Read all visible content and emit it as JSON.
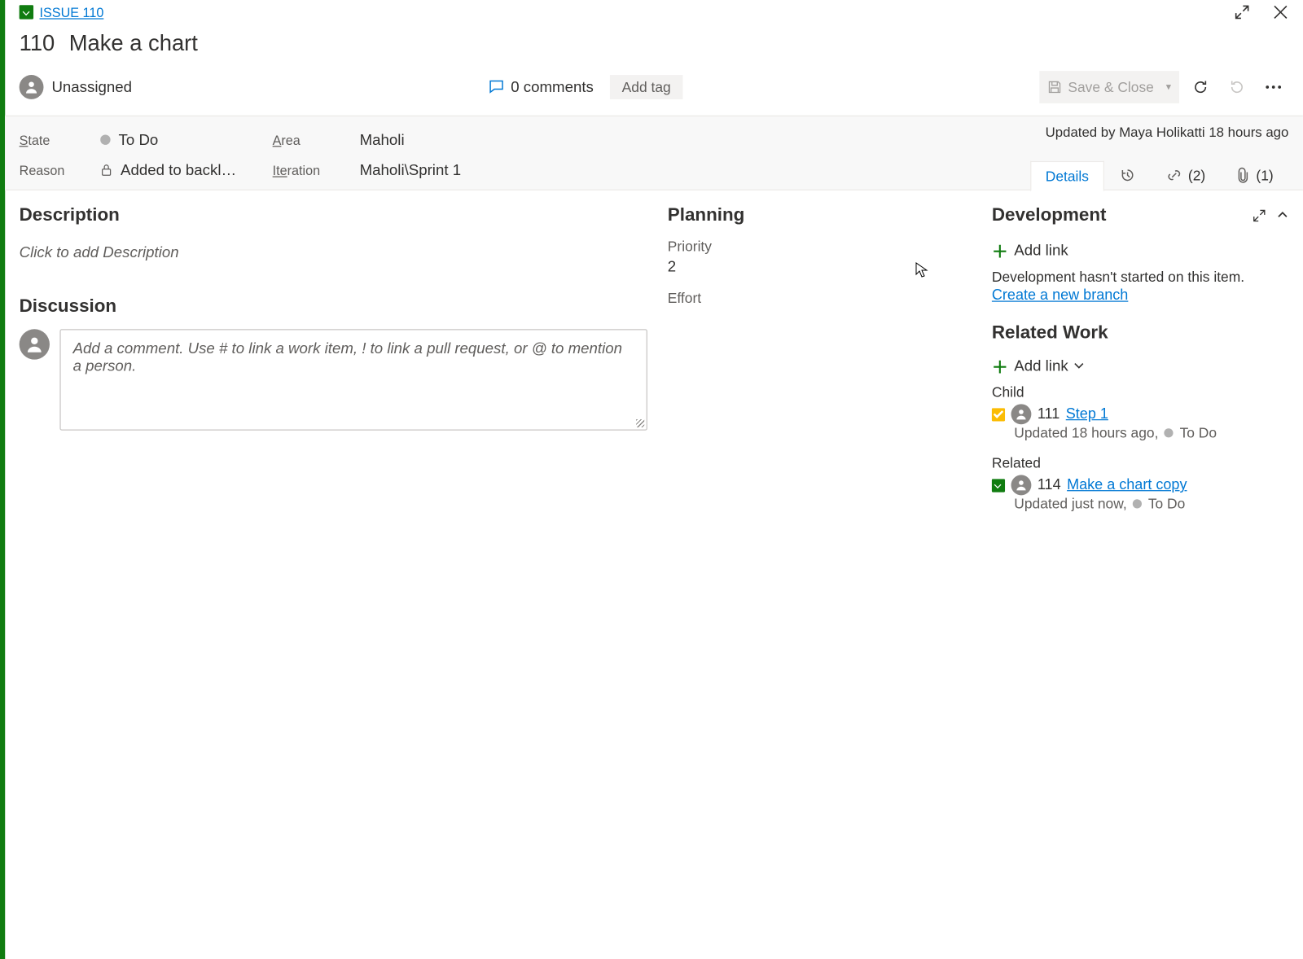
{
  "breadcrumb": {
    "label": "ISSUE 110"
  },
  "title": {
    "id": "110",
    "text": "Make a chart"
  },
  "assignee": {
    "text": "Unassigned"
  },
  "comments": {
    "text": "0 comments"
  },
  "add_tag": "Add tag",
  "save_close": "Save & Close",
  "info": {
    "state_label": "State",
    "state_value": "To Do",
    "area_label": "Area",
    "area_value": "Maholi",
    "reason_label": "Reason",
    "reason_value": "Added to backl…",
    "iteration_label": "Iteration",
    "iteration_value": "Maholi\\Sprint 1",
    "updated_by": "Updated by Maya Holikatti 18 hours ago"
  },
  "tabs": {
    "details": "Details",
    "links_count": "(2)",
    "attach_count": "(1)"
  },
  "description": {
    "heading": "Description",
    "placeholder": "Click to add Description"
  },
  "discussion": {
    "heading": "Discussion",
    "placeholder": "Add a comment. Use # to link a work item, ! to link a pull request, or @ to mention a person."
  },
  "planning": {
    "heading": "Planning",
    "priority_label": "Priority",
    "priority_value": "2",
    "effort_label": "Effort"
  },
  "development": {
    "heading": "Development",
    "add_link": "Add link",
    "msg": "Development hasn't started on this item.",
    "create_branch": "Create a new branch"
  },
  "related": {
    "heading": "Related Work",
    "add_link": "Add link",
    "child_label": "Child",
    "child_item": {
      "id": "111",
      "title": "Step 1",
      "sub": "Updated 18 hours ago,",
      "state": "To Do"
    },
    "related_label": "Related",
    "related_item": {
      "id": "114",
      "title": "Make a chart copy",
      "sub": "Updated just now,",
      "state": "To Do"
    }
  }
}
